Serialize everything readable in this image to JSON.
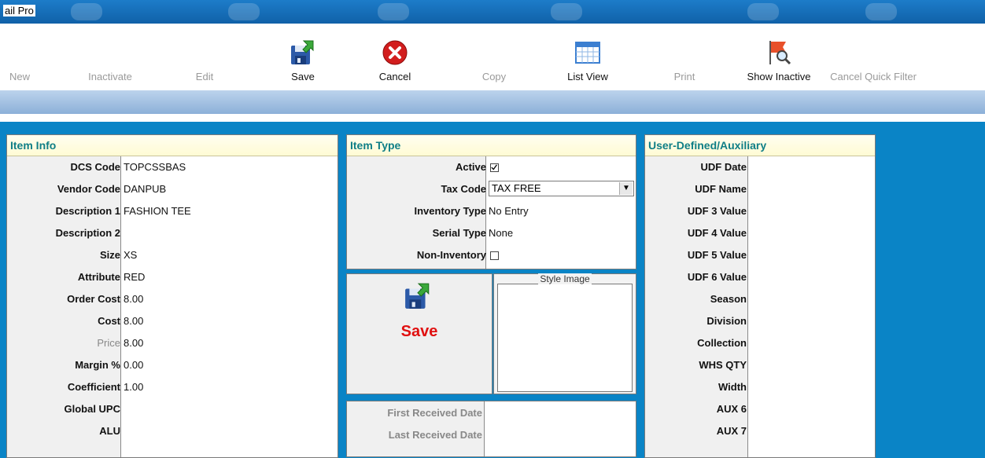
{
  "window": {
    "title": "ail Pro"
  },
  "toolbar": {
    "new": "New",
    "inactivate": "Inactivate",
    "edit": "Edit",
    "save": "Save",
    "cancel": "Cancel",
    "copy": "Copy",
    "list_view": "List View",
    "print": "Print",
    "show_inactive": "Show Inactive",
    "cancel_quick_filter": "Cancel Quick Filter"
  },
  "item_info": {
    "title": "Item Info",
    "fields": [
      {
        "label": "DCS Code",
        "value": "TOPCSSBAS"
      },
      {
        "label": "Vendor Code",
        "value": "DANPUB"
      },
      {
        "label": "Description 1",
        "value": "FASHION TEE"
      },
      {
        "label": "Description 2",
        "value": ""
      },
      {
        "label": "Size",
        "value": "XS"
      },
      {
        "label": "Attribute",
        "value": "RED"
      },
      {
        "label": "Order Cost",
        "value": "8.00"
      },
      {
        "label": "Cost",
        "value": "8.00"
      },
      {
        "label": "Price",
        "value": "8.00"
      },
      {
        "label": "Margin %",
        "value": "0.00"
      },
      {
        "label": "Coefficient",
        "value": "1.00"
      },
      {
        "label": "Global UPC",
        "value": ""
      },
      {
        "label": "ALU",
        "value": ""
      }
    ]
  },
  "item_type": {
    "title": "Item Type",
    "active_label": "Active",
    "active_checked": true,
    "tax_code_label": "Tax Code",
    "tax_code_value": "TAX FREE",
    "inventory_type_label": "Inventory Type",
    "inventory_type_value": "No Entry",
    "serial_type_label": "Serial Type",
    "serial_type_value": "None",
    "non_inventory_label": "Non-Inventory",
    "non_inventory_checked": false
  },
  "save_panel": {
    "label": "Save"
  },
  "style_image": {
    "title": "Style Image"
  },
  "dates": {
    "first_received_label": "First Received Date",
    "first_received_value": "",
    "last_received_label": "Last Received Date",
    "last_received_value": ""
  },
  "udf": {
    "title": "User-Defined/Auxiliary",
    "fields": [
      {
        "label": "UDF Date",
        "value": ""
      },
      {
        "label": "UDF Name",
        "value": ""
      },
      {
        "label": "UDF 3 Value",
        "value": ""
      },
      {
        "label": "UDF 4 Value",
        "value": ""
      },
      {
        "label": "UDF 5 Value",
        "value": ""
      },
      {
        "label": "UDF 6 Value",
        "value": ""
      },
      {
        "label": "Season",
        "value": ""
      },
      {
        "label": "Division",
        "value": ""
      },
      {
        "label": "Collection",
        "value": ""
      },
      {
        "label": "WHS QTY",
        "value": ""
      },
      {
        "label": "Width",
        "value": ""
      },
      {
        "label": "AUX 6",
        "value": ""
      },
      {
        "label": "AUX 7",
        "value": ""
      }
    ]
  },
  "colors": {
    "background": "#0a84c6",
    "header_text": "#0f7e86",
    "save_text": "#e01010"
  }
}
